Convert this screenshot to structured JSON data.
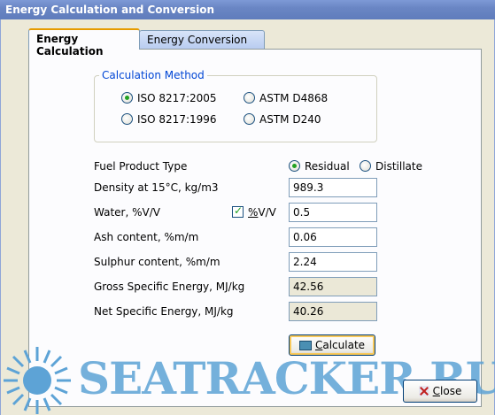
{
  "window": {
    "title": "Energy Calculation and Conversion"
  },
  "tabs": [
    {
      "label": "Energy Calculation",
      "active": true
    },
    {
      "label": "Energy Conversion",
      "active": false
    }
  ],
  "calc_method": {
    "legend": "Calculation Method",
    "options": [
      {
        "label": "ISO 8217:2005",
        "checked": true
      },
      {
        "label": "ASTM D4868",
        "checked": false
      },
      {
        "label": "ISO 8217:1996",
        "checked": false
      },
      {
        "label": "ASTM D240",
        "checked": false
      }
    ]
  },
  "form": {
    "fuel_type_label": "Fuel Product Type",
    "fuel_options": [
      {
        "label": "Residual",
        "checked": true
      },
      {
        "label": "Distillate",
        "checked": false
      }
    ],
    "density_label": "Density at 15°C, kg/m3",
    "density_value": "989.3",
    "water_label": "Water, %V/V",
    "water_check_prefix": "%",
    "water_check_label": "V/V",
    "water_value": "0.5",
    "ash_label": "Ash content, %m/m",
    "ash_value": "0.06",
    "sulphur_label": "Sulphur content, %m/m",
    "sulphur_value": "2.24",
    "gross_label": "Gross Specific Energy, MJ/kg",
    "gross_value": "42.56",
    "net_label": "Net Specific Energy, MJ/kg",
    "net_value": "40.26"
  },
  "buttons": {
    "calculate_prefix": "C",
    "calculate_label": "alculate",
    "close_prefix": "C",
    "close_label": "lose"
  },
  "watermark": "SEATRACKER.RU",
  "colors": {
    "accent": "#21a121",
    "title_bar": "#6a86c4",
    "watermark": "#5da3d6"
  }
}
